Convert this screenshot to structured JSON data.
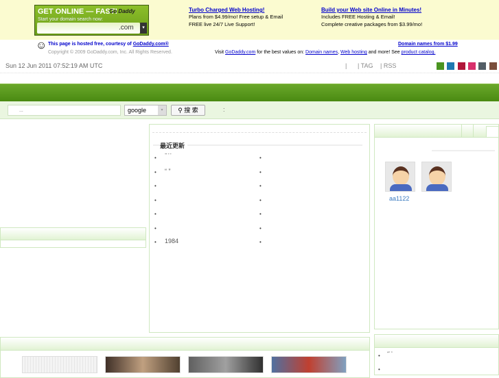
{
  "ad_banner": {
    "headline": "GET ONLINE — FAST!",
    "subline": "Start your domain search now:",
    "tld": ".com",
    "logo": "Go Daddy"
  },
  "ads": [
    {
      "title": "Turbo Charged Web Hosting!",
      "lines": [
        "Plans from $4.99/mo! Free setup & Email",
        "FREE live 24/7 Live Support!"
      ]
    },
    {
      "title": "Build your Web site Online in Minutes!",
      "lines": [
        "Includes FREE Hosting & Email!",
        "Complete creative packages from $3.99/mo!"
      ]
    }
  ],
  "hosting": {
    "prefix": "This page is hosted free, courtesy of ",
    "link": "GoDaddy.com®",
    "copyright": "Copyright © 2009 GoDaddy.com, Inc. All Rights Reserved.",
    "domain_link": "Domain names from $1.99",
    "visit": "Visit ",
    "visit_link": "GoDaddy.com",
    "visit_mid": " for the best values on: ",
    "l1": "Domain names",
    "comma": ", ",
    "l2": "Web hosting",
    "tail": " and more! See ",
    "l3": "product catalog."
  },
  "toolbar": {
    "date": "Sun 12 Jun 2011 07:52:19 AM UTC",
    "sep": "|",
    "tag": "| TAG",
    "rss": "| RSS"
  },
  "theme_colors": [
    "#4a9420",
    "#1f78b0",
    "#b0163a",
    "#d8306c",
    "#535e66",
    "#7a4e3c"
  ],
  "search": {
    "placeholder": "...",
    "engine": "google",
    "button": "搜 索",
    "colon": ":"
  },
  "recent": {
    "title": "最近更新",
    "left": [
      "“” ” ”",
      "“ ”",
      "",
      "",
      "",
      "",
      "1984"
    ]
  },
  "user": {
    "name": "aa1122"
  },
  "side_bottom": {
    "item": "“” ”"
  }
}
